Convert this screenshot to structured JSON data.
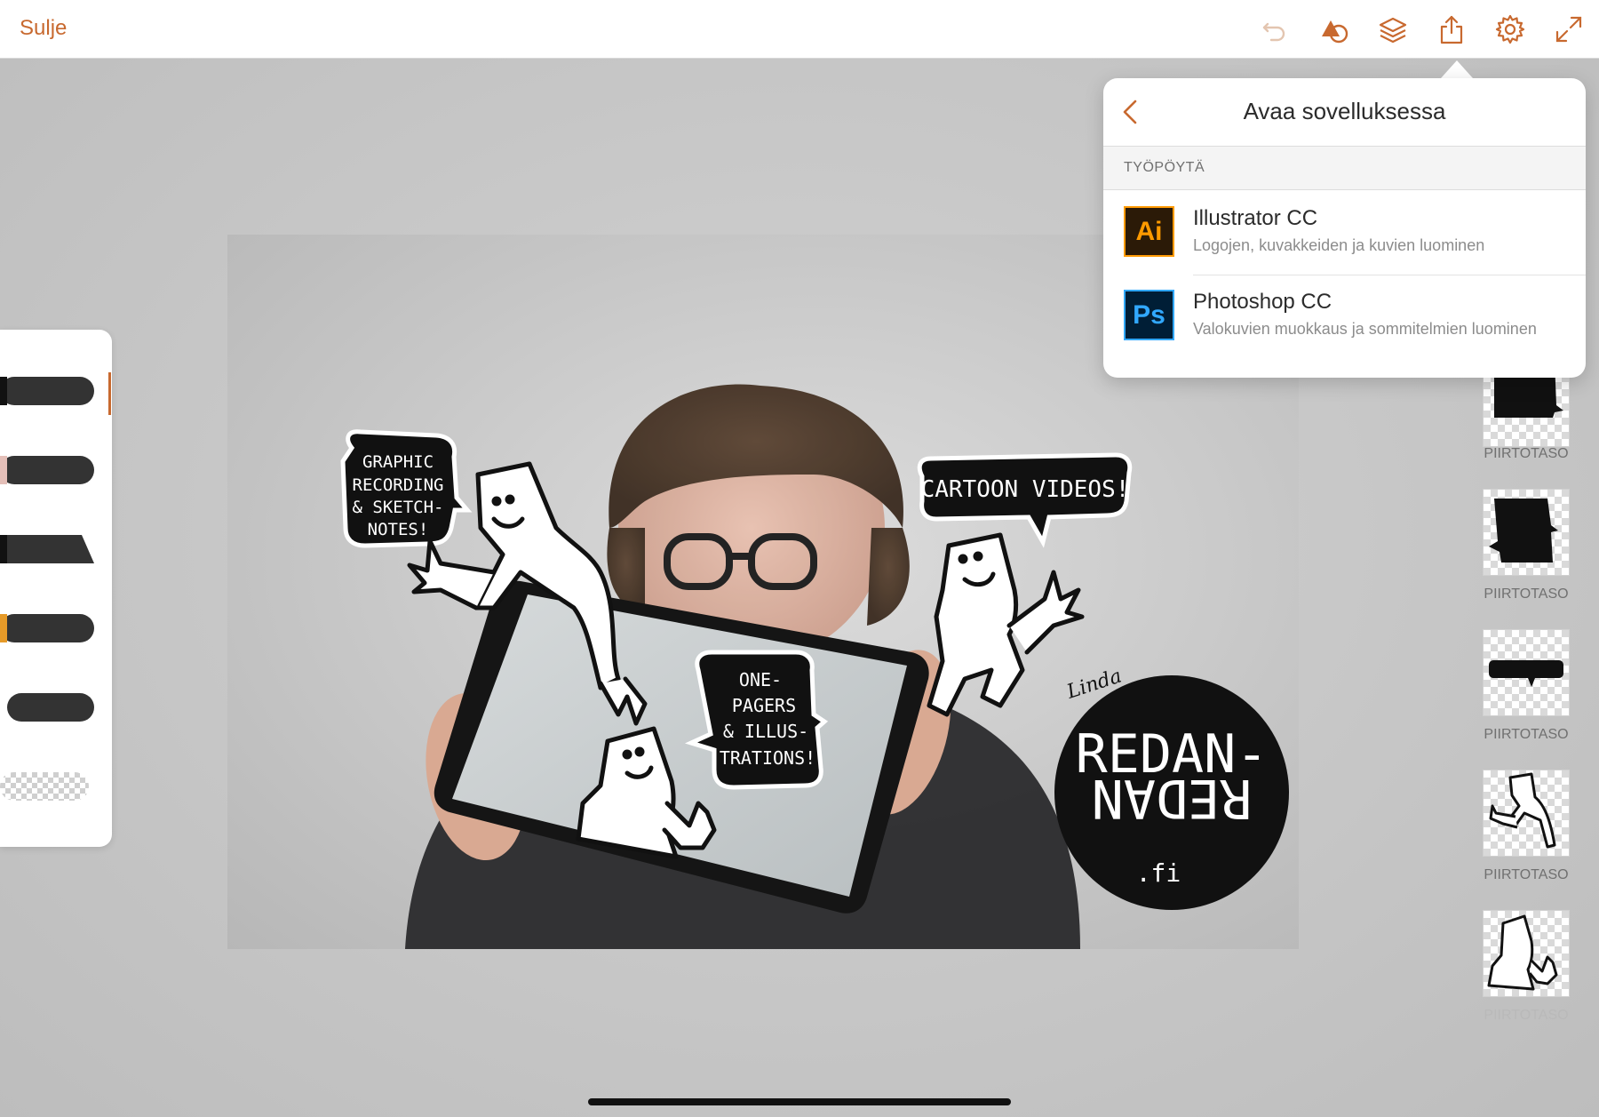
{
  "topbar": {
    "close_label": "Sulje",
    "tools": [
      {
        "icon": "undo-icon"
      },
      {
        "icon": "shapes-icon"
      },
      {
        "icon": "layers-icon"
      },
      {
        "icon": "share-icon"
      },
      {
        "icon": "settings-icon"
      },
      {
        "icon": "fullscreen-icon"
      }
    ]
  },
  "artwork": {
    "bubble_1": [
      "GRAPHIC",
      "RECORDING",
      "& SKETCH-",
      "NOTES!"
    ],
    "bubble_2": "CARTOON VIDEOS!",
    "bubble_3": [
      "ONE-",
      "PAGERS",
      "& ILLUS-",
      "TRATIONS!"
    ],
    "logo_line_1": "REDAN-",
    "logo_line_2": "REDAN",
    "logo_suffix": ".fi",
    "signature": "Linda"
  },
  "layers": {
    "items": [
      {
        "label": "PIIRTOTASO",
        "dimmed": false
      },
      {
        "label": "PIIRTOTASO",
        "dimmed": false
      },
      {
        "label": "PIIRTOTASO",
        "dimmed": false
      },
      {
        "label": "PIIRTOTASO",
        "dimmed": false
      },
      {
        "label": "PIIRTOTASO",
        "dimmed": true
      }
    ]
  },
  "popover": {
    "title": "Avaa sovelluksessa",
    "section_label": "TYÖPÖYTÄ",
    "apps": [
      {
        "icon_text": "Ai",
        "name": "Illustrator CC",
        "description": "Logojen, kuvakkeiden ja kuvien luominen",
        "icon_bg": "#2b1a07",
        "icon_fg": "#ff9a00"
      },
      {
        "icon_text": "Ps",
        "name": "Photoshop CC",
        "description": "Valokuvien muokkaus ja sommitelmien luominen",
        "icon_bg": "#001e36",
        "icon_fg": "#31a8ff"
      }
    ]
  },
  "colors": {
    "accent": "#c8692f"
  }
}
